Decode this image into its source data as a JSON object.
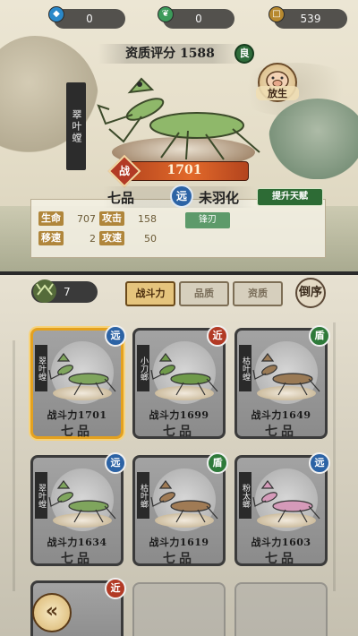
{
  "resources": {
    "gem": {
      "value": "0",
      "icon": "blue-gem-icon",
      "color": "#2a88c9"
    },
    "jade": {
      "value": "0",
      "icon": "green-jade-icon",
      "color": "#3c9a5a"
    },
    "coin": {
      "value": "539",
      "icon": "copper-coin-icon",
      "color": "#b7892f"
    }
  },
  "selected": {
    "score_label": "资质评分 1588",
    "grade": "良",
    "release_label": "放生",
    "name": "翠叶螳",
    "power_icon": "战",
    "power": "1701",
    "rank": "七品",
    "type": "远",
    "status": "未羽化",
    "upgrade_label": "提升天赋",
    "stats": [
      {
        "label": "生命",
        "value": "707"
      },
      {
        "label": "攻击",
        "value": "158"
      },
      {
        "label": "移速",
        "value": "2"
      },
      {
        "label": "攻速",
        "value": "50"
      }
    ],
    "equip_label": "锋刃"
  },
  "filter": {
    "count": "7",
    "tabs": [
      {
        "label": "战斗力",
        "active": true
      },
      {
        "label": "品质",
        "active": false
      },
      {
        "label": "资质",
        "active": false
      }
    ],
    "order_label": "倒序"
  },
  "cards": [
    {
      "name": "翠叶螳",
      "type": "远",
      "type_color": "#2c63a5",
      "power": "战斗力1701",
      "rank": "七品",
      "body_color": "#7fa55d"
    },
    {
      "name": "小刀螂",
      "type": "近",
      "type_color": "#b23a25",
      "power": "战斗力1699",
      "rank": "七品",
      "body_color": "#6f9a4a"
    },
    {
      "name": "枯叶螳",
      "type": "盾",
      "type_color": "#2e7a3a",
      "power": "战斗力1649",
      "rank": "七品",
      "body_color": "#9a7a55"
    },
    {
      "name": "翠叶螳",
      "type": "远",
      "type_color": "#2c63a5",
      "power": "战斗力1634",
      "rank": "七品",
      "body_color": "#7fa55d"
    },
    {
      "name": "枯叶螂",
      "type": "盾",
      "type_color": "#2e7a3a",
      "power": "战斗力1619",
      "rank": "七品",
      "body_color": "#a07b55"
    },
    {
      "name": "粉太螂",
      "type": "远",
      "type_color": "#2c63a5",
      "power": "战斗力1603",
      "rank": "七品",
      "body_color": "#d59ab9"
    }
  ],
  "partial_card": {
    "type": "近",
    "type_color": "#b23a25"
  },
  "back_icon": "back-arrow-icon"
}
